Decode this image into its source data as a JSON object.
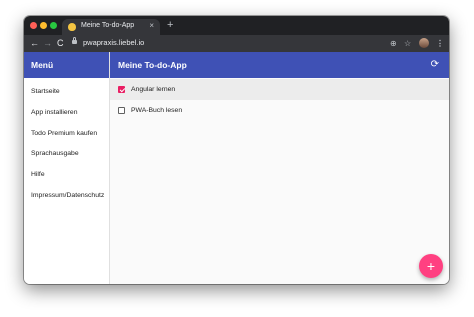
{
  "browser": {
    "tab_title": "Meine To-do-App",
    "tab_close": "×",
    "new_tab": "+",
    "back": "←",
    "forward": "→",
    "reload": "C",
    "url": "pwapraxis.liebel.io",
    "install_icon": "⊕",
    "star_icon": "☆",
    "menu_icon": "⋮",
    "icons": [
      "favicon-icon",
      "lock-icon",
      "install-icon",
      "star-icon",
      "avatar",
      "more-icon"
    ]
  },
  "sidenav": {
    "title": "Menü",
    "items": [
      {
        "label": "Startseite"
      },
      {
        "label": "App installieren"
      },
      {
        "label": "Todo Premium kaufen"
      },
      {
        "label": "Sprachausgabe"
      },
      {
        "label": "Hilfe"
      },
      {
        "label": "Impressum/Datenschutz"
      }
    ]
  },
  "main": {
    "title": "Meine To-do-App",
    "sync_icon": "⟳",
    "todos": [
      {
        "label": "Angular lernen",
        "done": true
      },
      {
        "label": "PWA-Buch lesen",
        "done": false
      }
    ],
    "fab_label": "+"
  },
  "colors": {
    "primary": "#3f51b5",
    "accent": "#ff4081",
    "checkbox": "#e91e63"
  }
}
